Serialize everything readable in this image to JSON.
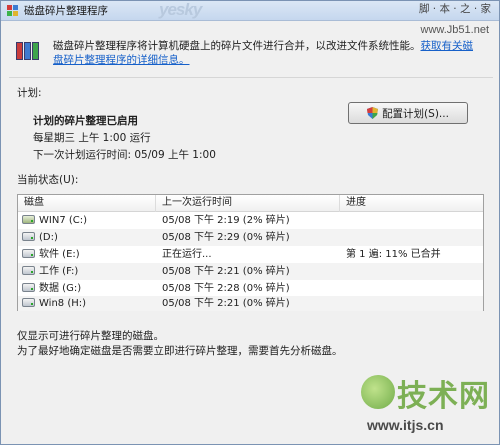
{
  "window": {
    "title": "磁盘碎片整理程序",
    "watermark_top": "yesky",
    "watermark_right": "脚 · 本 · 之 · 家",
    "watermark_url": "www.Jb51.net"
  },
  "description": {
    "text": "磁盘碎片整理程序将计算机硬盘上的碎片文件进行合并，以改进文件系统性能。",
    "link": "获取有关磁盘碎片整理程序的详细信息。"
  },
  "schedule": {
    "section_label": "计划:",
    "title": "计划的碎片整理已启用",
    "line1": "每星期三 上午 1:00 运行",
    "line2": "下一次计划运行时间: 05/09 上午 1:00",
    "configure_button": "配置计划(S)..."
  },
  "status": {
    "section_label": "当前状态(U):",
    "columns": [
      "磁盘",
      "上一次运行时间",
      "进度"
    ],
    "rows": [
      {
        "disk": "WIN7 (C:)",
        "last_run": "05/08 下午 2:19 (2% 碎片)",
        "progress": "",
        "icon": "system-drive-icon"
      },
      {
        "disk": "(D:)",
        "last_run": "05/08 下午 2:29 (0% 碎片)",
        "progress": "",
        "icon": "drive-icon"
      },
      {
        "disk": "软件 (E:)",
        "last_run": "正在运行...",
        "progress": "第 1 遍: 11% 已合并",
        "icon": "drive-icon"
      },
      {
        "disk": "工作 (F:)",
        "last_run": "05/08 下午 2:21 (0% 碎片)",
        "progress": "",
        "icon": "drive-icon"
      },
      {
        "disk": "数据 (G:)",
        "last_run": "05/08 下午 2:28 (0% 碎片)",
        "progress": "",
        "icon": "drive-icon"
      },
      {
        "disk": "Win8 (H:)",
        "last_run": "05/08 下午 2:21 (0% 碎片)",
        "progress": "",
        "icon": "drive-icon"
      }
    ]
  },
  "footer": {
    "line1": "仅显示可进行碎片整理的磁盘。",
    "line2": "为了最好地确定磁盘是否需要立即进行碎片整理，需要首先分析磁盘。"
  },
  "watermark_bottom": {
    "big": "技术网",
    "url": "www.itjs.cn"
  },
  "colors": {
    "link": "#1660c9",
    "window_bg": "#f0f0f0",
    "titlebar": "#c5d7ee"
  }
}
